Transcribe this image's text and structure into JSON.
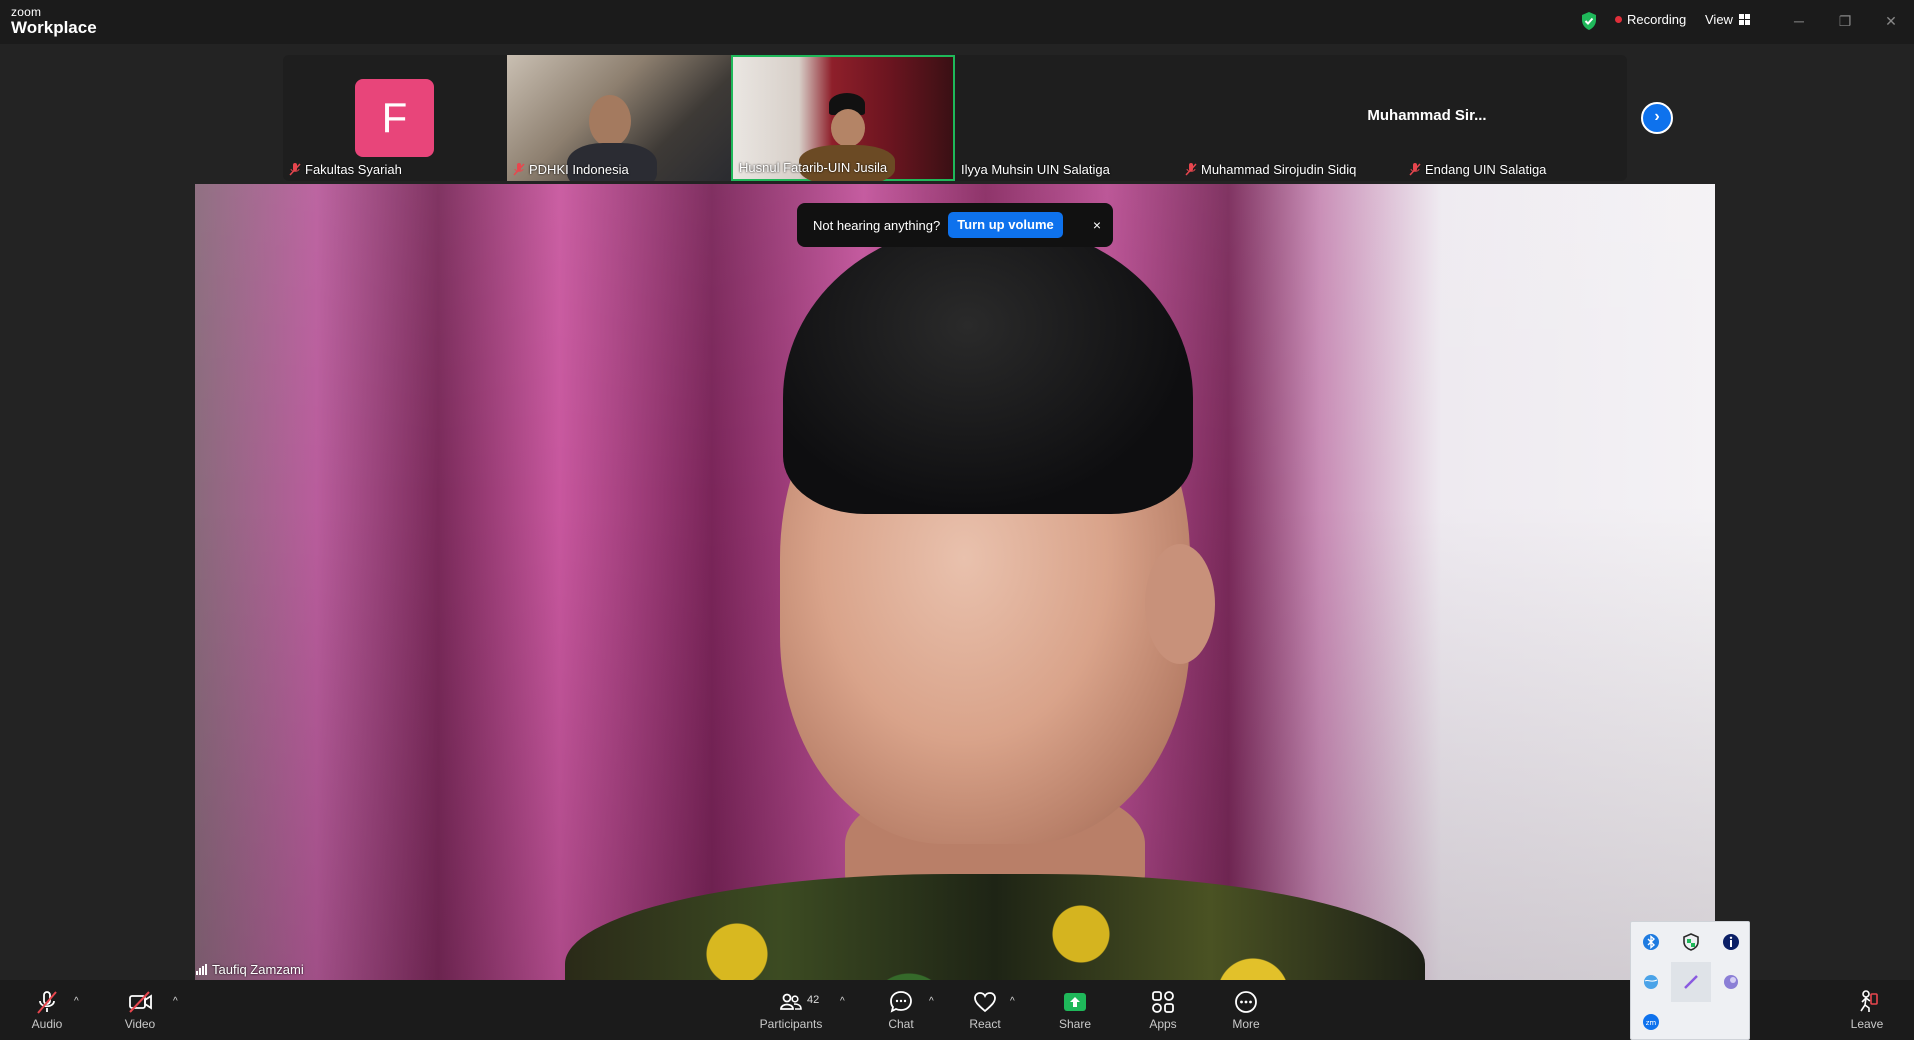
{
  "titlebar": {
    "brand_small": "zoom",
    "brand_big": "Workplace",
    "recording_label": "Recording",
    "view_label": "View",
    "colors": {
      "recording": "#e02f3a",
      "shield": "#1fb85a"
    }
  },
  "strip": {
    "tiles": [
      {
        "name": "Fakultas Syariah",
        "avatar_letter": "F",
        "muted": true
      },
      {
        "name": "PDHKI Indonesia",
        "muted": true
      },
      {
        "name": "Husnul Fatarib-UIN Jusila",
        "muted": false
      },
      {
        "name": "Ilyya Muhsin UIN Salatiga",
        "muted": false
      },
      {
        "name": "Muhammad Sirojudin Sidiq",
        "muted": true
      },
      {
        "name": "Endang UIN Salatiga",
        "muted": true
      }
    ],
    "active_speaker_display": "Muhammad  Sir...",
    "next_icon": "chevron-right-icon",
    "accent": "#0e72ed"
  },
  "main_video": {
    "speaker_name": "Taufiq Zamzami"
  },
  "toast": {
    "message": "Not hearing anything?",
    "button_label": "Turn up volume",
    "close_glyph": "×"
  },
  "toolbar": {
    "audio_label": "Audio",
    "video_label": "Video",
    "participants_label": "Participants",
    "participants_count": "42",
    "chat_label": "Chat",
    "react_label": "React",
    "share_label": "Share",
    "apps_label": "Apps",
    "more_label": "More",
    "leave_label": "Leave",
    "share_color": "#1fb85a"
  },
  "tray": {
    "icons": [
      "bluetooth-icon",
      "security-shield-icon",
      "info-icon",
      "network-globe-icon",
      "pen-icon",
      "orb-icon",
      "zoom-icon"
    ],
    "zoom_badge": "zm"
  }
}
